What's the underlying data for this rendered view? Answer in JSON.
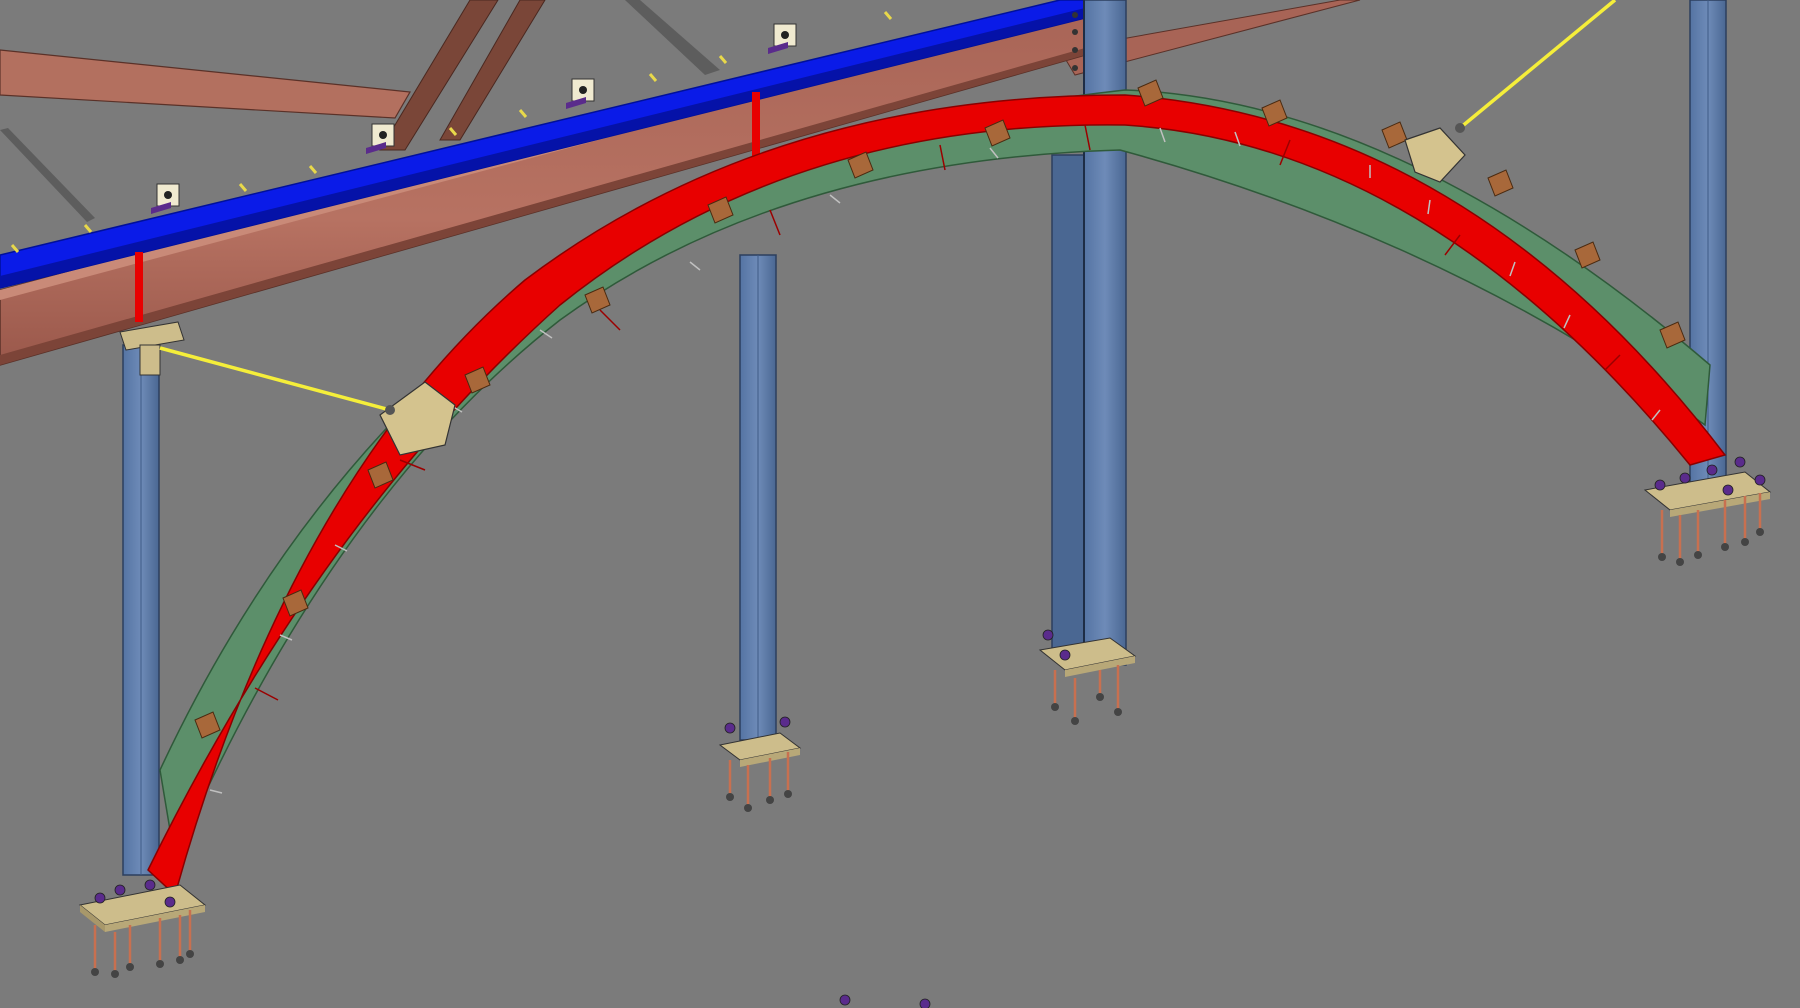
{
  "view": {
    "background_color": "#7b7b7b"
  },
  "colors": {
    "arch_red": "#e80000",
    "arch_red_dark": "#b30000",
    "arch_web_green": "#5c8f6a",
    "arch_web_green_dark": "#3d6d4d",
    "purlin_blue": "#0a1be8",
    "purlin_blue_dark": "#00109a",
    "rafter_brown": "#b26a5c",
    "rafter_brown_light": "#c98a78",
    "rafter_brown_dark": "#7c4438",
    "truss_brown": "#7a4638",
    "column_blue": "#6481ad",
    "column_blue_dark": "#3e5a85",
    "base_plate_tan": "#cdbd8b",
    "gusset_tan": "#d4c38e",
    "clip_orange": "#a8683a",
    "bracing_yellow": "#f5ee3a",
    "anchor_bolt": "#c87050",
    "bolt_purple": "#5a2b8c",
    "bracket_white": "#f0ead0"
  },
  "components": {
    "arch": "curved-arch-beam",
    "columns": [
      "column-left",
      "column-center-left",
      "column-center",
      "column-right"
    ],
    "rafter": "rafter-beam",
    "purlin": "purlin-beam",
    "bracing": [
      "tie-rod-left",
      "tie-rod-right"
    ],
    "base_plates": [
      "base-plate-left",
      "base-plate-center-left",
      "base-plate-center",
      "base-plate-right"
    ]
  },
  "icons": {
    "anchor_bolt": "anchor-bolt-icon",
    "clip": "clip-angle-icon",
    "nut": "nut-icon"
  }
}
